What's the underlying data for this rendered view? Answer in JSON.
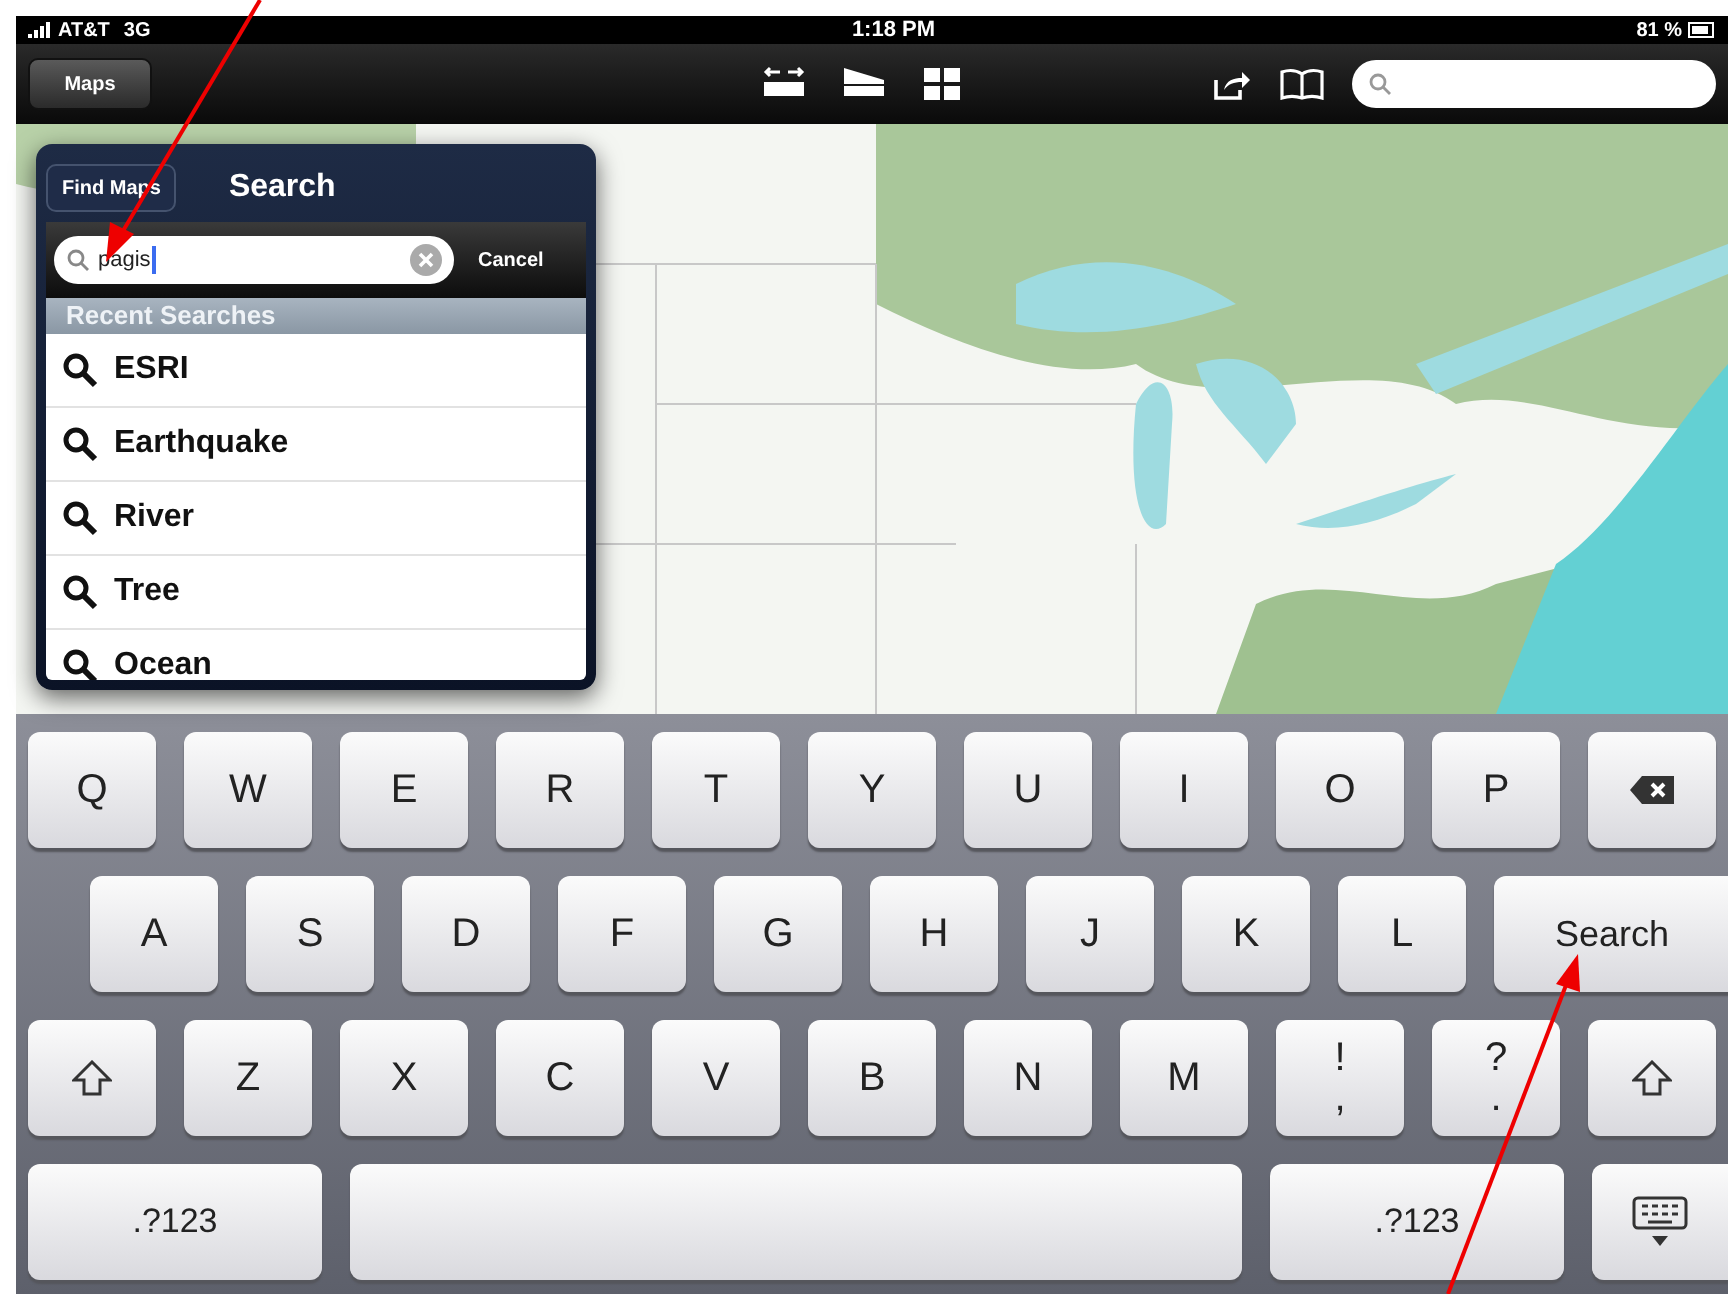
{
  "status_bar": {
    "carrier": "AT&T",
    "network": "3G",
    "time": "1:18 PM",
    "battery": "81 %"
  },
  "toolbar": {
    "maps_button": "Maps"
  },
  "popover": {
    "back_button": "Find Maps",
    "title": "Search",
    "search": {
      "value": "pagis"
    },
    "cancel": "Cancel",
    "section": "Recent Searches",
    "items": [
      {
        "label": "ESRI"
      },
      {
        "label": "Earthquake"
      },
      {
        "label": "River"
      },
      {
        "label": "Tree"
      },
      {
        "label": "Ocean"
      }
    ]
  },
  "keyboard": {
    "rows": [
      [
        {
          "kind": "char",
          "label": "Q"
        },
        {
          "kind": "char",
          "label": "W"
        },
        {
          "kind": "char",
          "label": "E"
        },
        {
          "kind": "char",
          "label": "R"
        },
        {
          "kind": "char",
          "label": "T"
        },
        {
          "kind": "char",
          "label": "Y"
        },
        {
          "kind": "char",
          "label": "U"
        },
        {
          "kind": "char",
          "label": "I"
        },
        {
          "kind": "char",
          "label": "O"
        },
        {
          "kind": "char",
          "label": "P"
        },
        {
          "kind": "backspace"
        }
      ],
      [
        {
          "kind": "char",
          "label": "A"
        },
        {
          "kind": "char",
          "label": "S"
        },
        {
          "kind": "char",
          "label": "D"
        },
        {
          "kind": "char",
          "label": "F"
        },
        {
          "kind": "char",
          "label": "G"
        },
        {
          "kind": "char",
          "label": "H"
        },
        {
          "kind": "char",
          "label": "J"
        },
        {
          "kind": "char",
          "label": "K"
        },
        {
          "kind": "char",
          "label": "L"
        },
        {
          "kind": "search",
          "label": "Search"
        }
      ],
      [
        {
          "kind": "shift"
        },
        {
          "kind": "char",
          "label": "Z"
        },
        {
          "kind": "char",
          "label": "X"
        },
        {
          "kind": "char",
          "label": "C"
        },
        {
          "kind": "char",
          "label": "V"
        },
        {
          "kind": "char",
          "label": "B"
        },
        {
          "kind": "char",
          "label": "N"
        },
        {
          "kind": "char",
          "label": "M"
        },
        {
          "kind": "dual",
          "label": "!",
          "sub": ","
        },
        {
          "kind": "dual",
          "label": "?",
          "sub": "."
        },
        {
          "kind": "shift"
        }
      ],
      [
        {
          "kind": "numbers",
          "label": ".?123"
        },
        {
          "kind": "space"
        },
        {
          "kind": "numbers",
          "label": ".?123"
        },
        {
          "kind": "hide"
        }
      ]
    ]
  }
}
